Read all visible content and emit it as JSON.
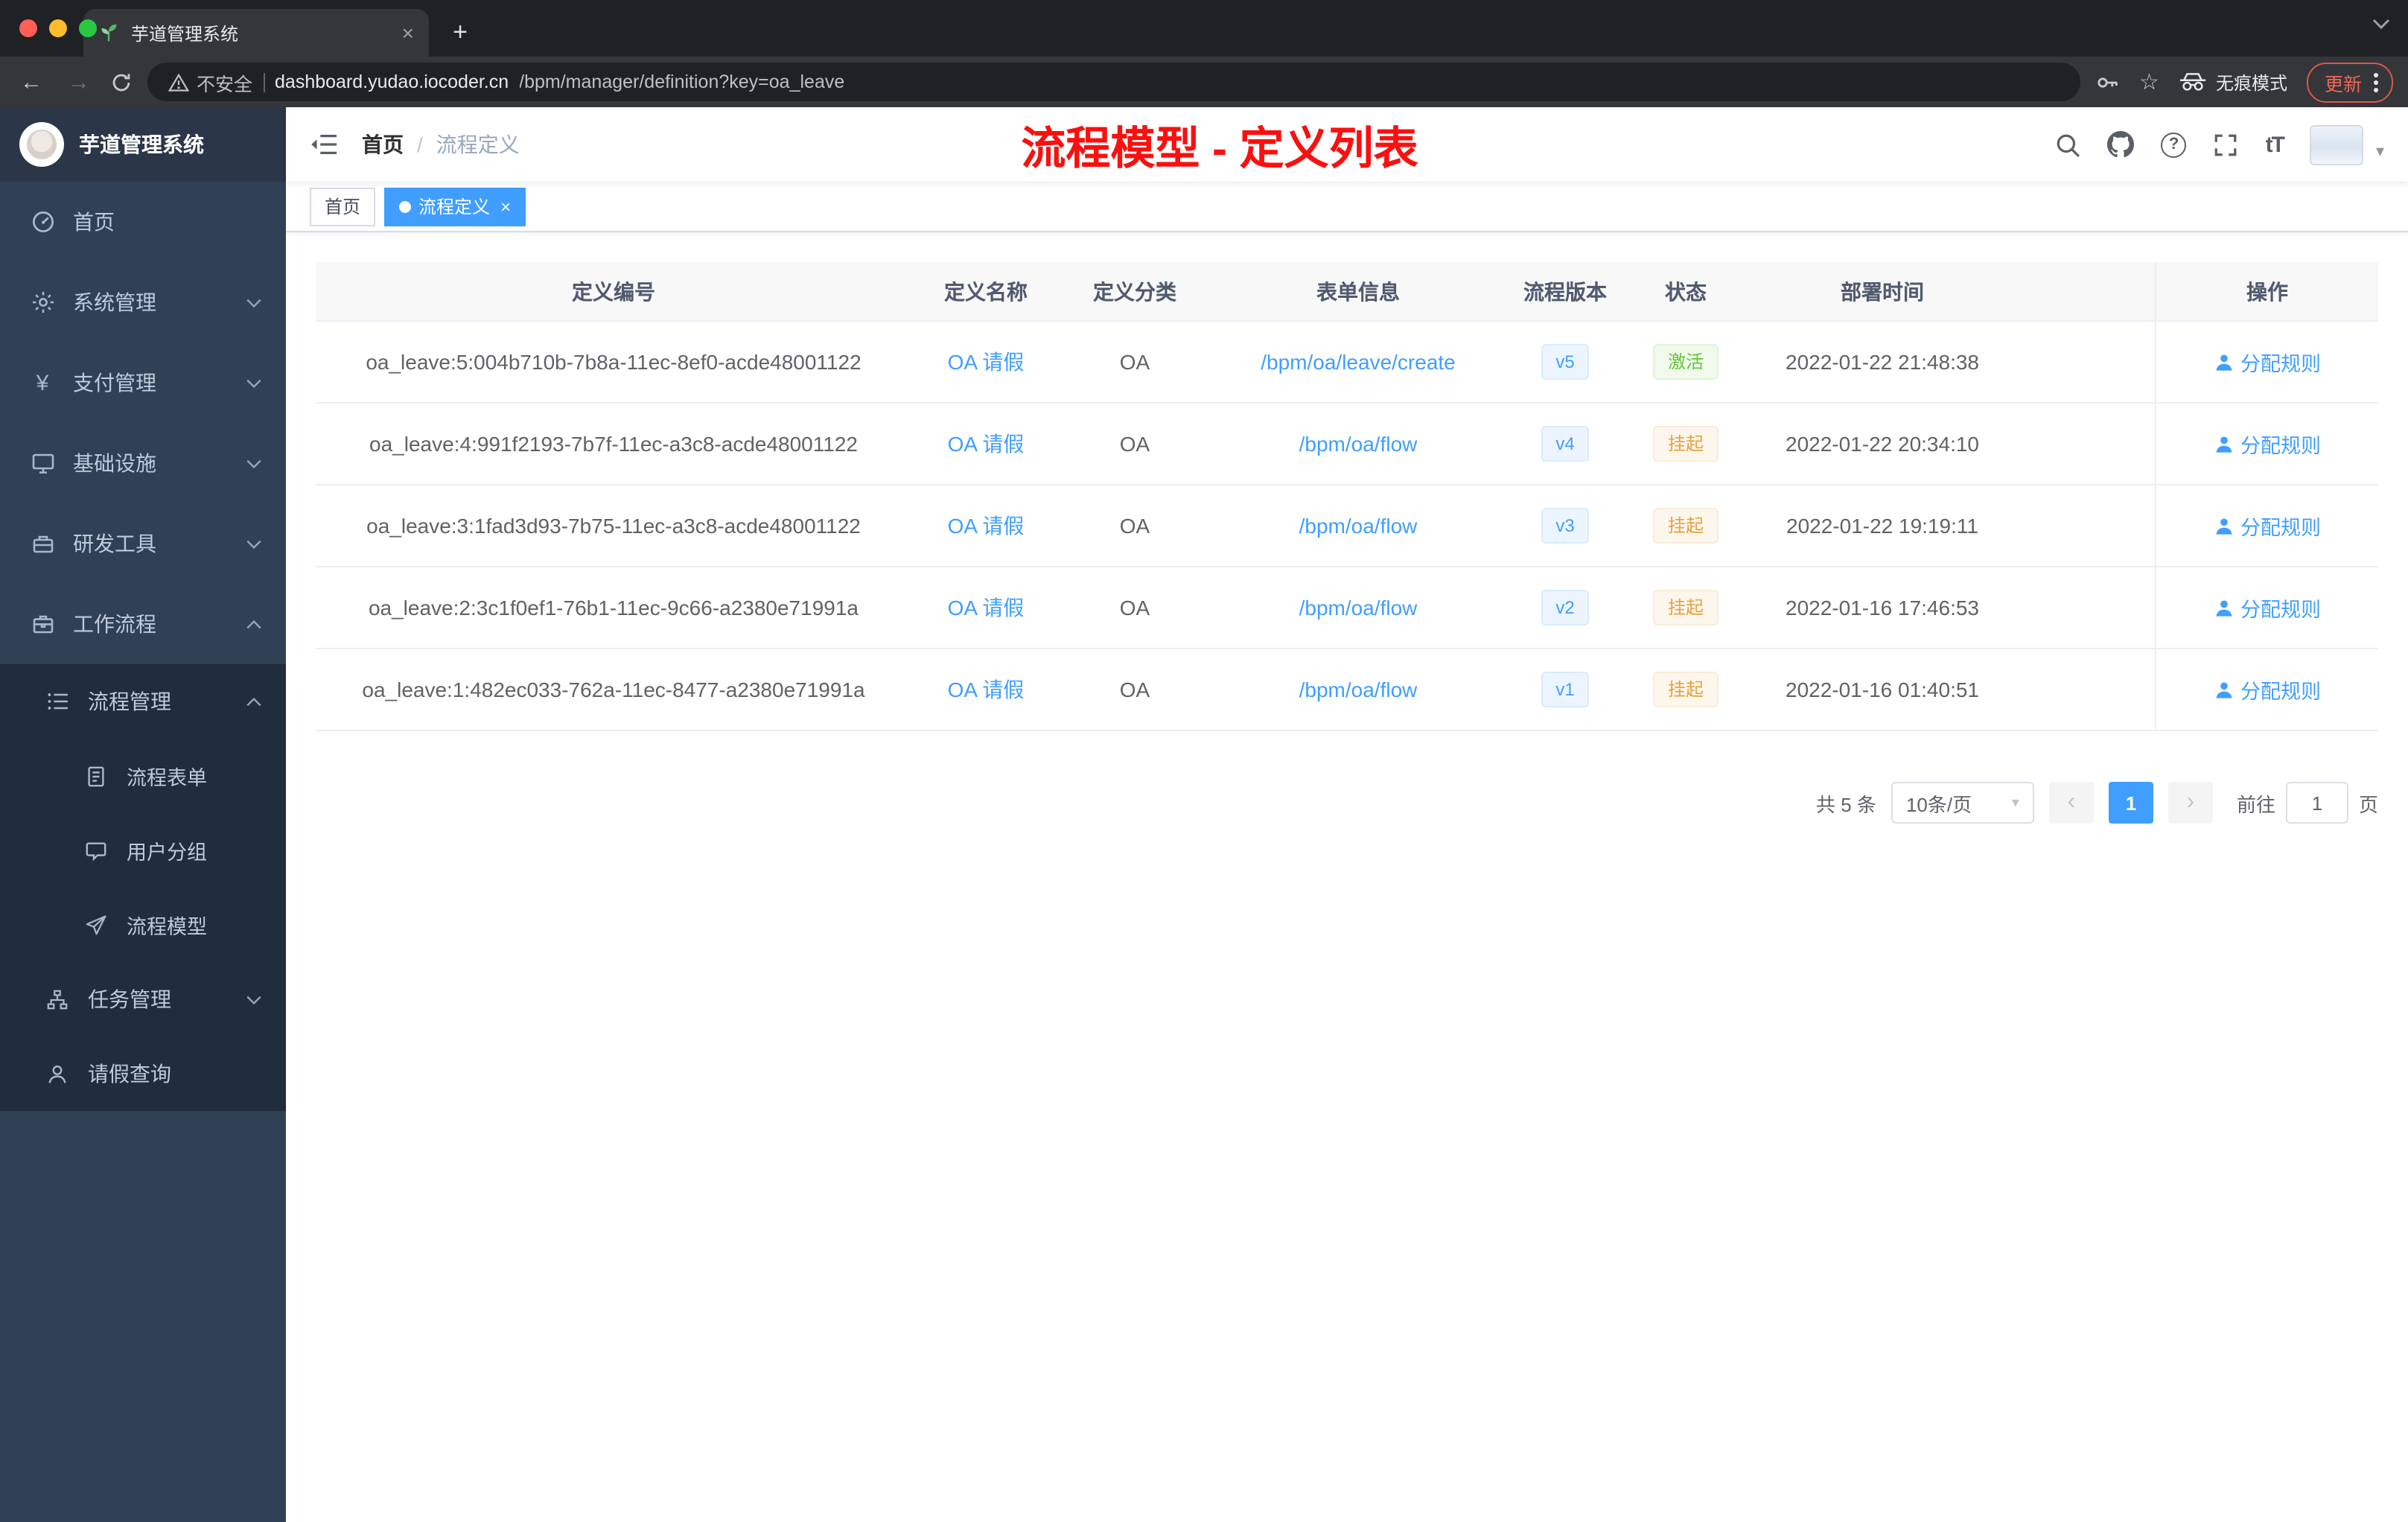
{
  "glyphs": {
    "close": "×",
    "plus": "+",
    "back": "←",
    "forward": "→",
    "star": "☆",
    "breadcrumb_sep": "/",
    "caret_down": "▾",
    "prev": "‹",
    "next": "›",
    "question": "?",
    "font_size": "tT",
    "yen": "¥"
  },
  "browser": {
    "tab_title": "芋道管理系统",
    "security_label": "不安全",
    "url_host": "dashboard.yudao.iocoder.cn",
    "url_path": "/bpm/manager/definition?key=oa_leave",
    "incognito_label": "无痕模式",
    "update_label": "更新"
  },
  "sidebar": {
    "app_title": "芋道管理系统",
    "items": [
      {
        "label": "首页"
      },
      {
        "label": "系统管理"
      },
      {
        "label": "支付管理"
      },
      {
        "label": "基础设施"
      },
      {
        "label": "研发工具"
      },
      {
        "label": "工作流程"
      }
    ],
    "workflow_submenu": [
      {
        "label": "流程管理"
      },
      {
        "label": "流程表单"
      },
      {
        "label": "用户分组"
      },
      {
        "label": "流程模型"
      },
      {
        "label": "任务管理"
      },
      {
        "label": "请假查询"
      }
    ]
  },
  "navbar": {
    "breadcrumb_home": "首页",
    "breadcrumb_current": "流程定义",
    "annotation": "流程模型 - 定义列表"
  },
  "tags": {
    "home": "首页",
    "current": "流程定义"
  },
  "table": {
    "headers": [
      "定义编号",
      "定义名称",
      "定义分类",
      "表单信息",
      "流程版本",
      "状态",
      "部署时间",
      "操作"
    ],
    "action_label": "分配规则",
    "rows": [
      {
        "id": "oa_leave:5:004b710b-7b8a-11ec-8ef0-acde48001122",
        "name": "OA 请假",
        "category": "OA",
        "form": "/bpm/oa/leave/create",
        "version": "v5",
        "status": "激活",
        "status_type": "success",
        "deployed": "2022-01-22 21:48:38"
      },
      {
        "id": "oa_leave:4:991f2193-7b7f-11ec-a3c8-acde48001122",
        "name": "OA 请假",
        "category": "OA",
        "form": "/bpm/oa/flow",
        "version": "v4",
        "status": "挂起",
        "status_type": "warning",
        "deployed": "2022-01-22 20:34:10"
      },
      {
        "id": "oa_leave:3:1fad3d93-7b75-11ec-a3c8-acde48001122",
        "name": "OA 请假",
        "category": "OA",
        "form": "/bpm/oa/flow",
        "version": "v3",
        "status": "挂起",
        "status_type": "warning",
        "deployed": "2022-01-22 19:19:11"
      },
      {
        "id": "oa_leave:2:3c1f0ef1-76b1-11ec-9c66-a2380e71991a",
        "name": "OA 请假",
        "category": "OA",
        "form": "/bpm/oa/flow",
        "version": "v2",
        "status": "挂起",
        "status_type": "warning",
        "deployed": "2022-01-16 17:46:53"
      },
      {
        "id": "oa_leave:1:482ec033-762a-11ec-8477-a2380e71991a",
        "name": "OA 请假",
        "category": "OA",
        "form": "/bpm/oa/flow",
        "version": "v1",
        "status": "挂起",
        "status_type": "warning",
        "deployed": "2022-01-16 01:40:51"
      }
    ]
  },
  "pagination": {
    "total": "共 5 条",
    "page_size": "10条/页",
    "current_page": "1",
    "goto_label": "前往",
    "goto_value": "1",
    "page_label": "页"
  }
}
